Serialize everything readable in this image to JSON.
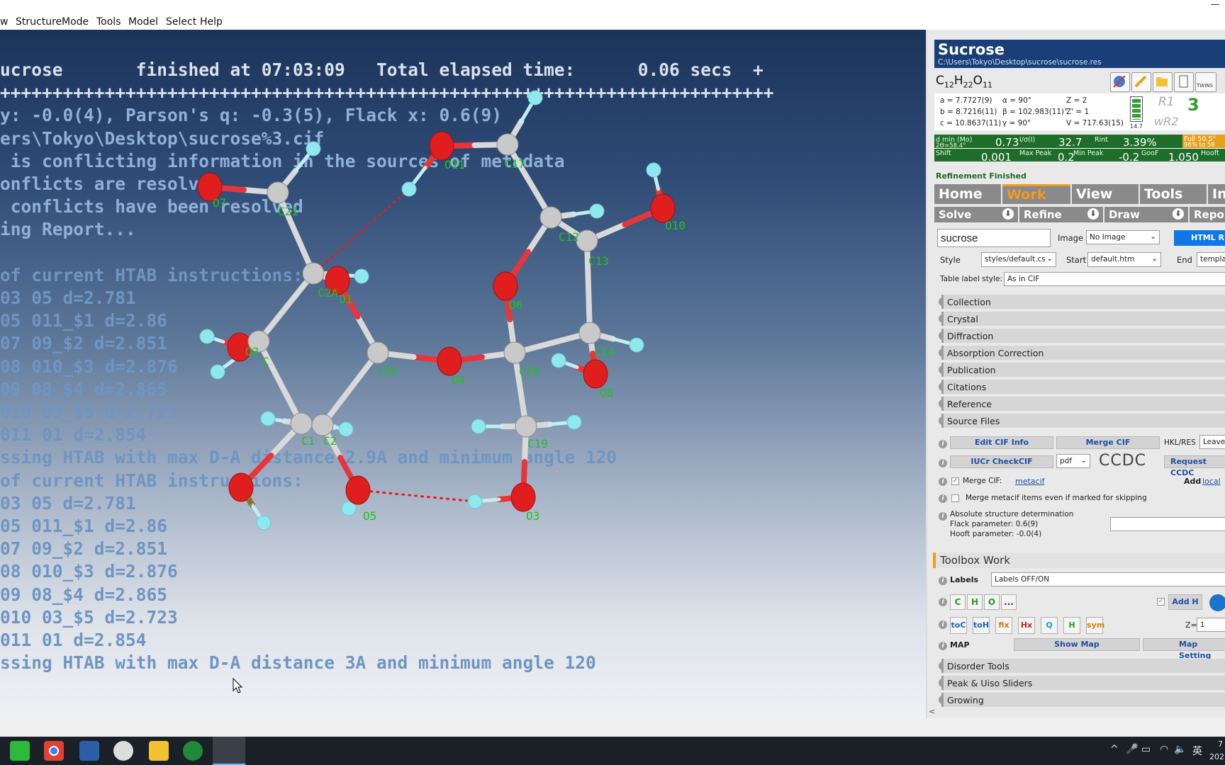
{
  "menu": [
    "w",
    "Structure",
    "Mode",
    "Tools",
    "Model",
    "Select",
    "Help"
  ],
  "console": {
    "lines": [
      {
        "text": "ucrose       finished at 07:03:09   Total elapsed time:      0.06 secs  +",
        "color": "#d8e1ec"
      },
      {
        "text": "++++++++++++++++++++++++++++++++++++++++++++++++++++++++++++++++++++++++++",
        "color": "#d8e1ec"
      },
      {
        "text": "y: -0.0(4), Parson's q: -0.3(5), Flack x: 0.6(9)",
        "color": "#8fb0d8"
      },
      {
        "text": "ers\\Tokyo\\Desktop\\sucrose%3.cif",
        "color": "#8fb0d8"
      },
      {
        "text": " is conflicting information in the sources of metadata",
        "color": "#8fb0d8"
      },
      {
        "text": "onflicts are resolved",
        "color": "#8fb0d8"
      },
      {
        "text": " conflicts have been resolved",
        "color": "#8fb0d8"
      },
      {
        "text": "ing Report...",
        "color": "#8fb0d8"
      },
      {
        "text": "",
        "color": "#8fb0d8"
      },
      {
        "text": "of current HTAB instructions:",
        "color": "#6f95c2"
      },
      {
        "text": "03 05 d=2.781",
        "color": "#6f95c2"
      },
      {
        "text": "05 011_$1 d=2.86",
        "color": "#6f95c2"
      },
      {
        "text": "07 09_$2 d=2.851",
        "color": "#6f95c2"
      },
      {
        "text": "08 010_$3 d=2.876",
        "color": "#6f95c2"
      },
      {
        "text": "09 08_$4 d=2.865",
        "color": "#6f95c2"
      },
      {
        "text": "010 03_$5 d=2.723",
        "color": "#6f95c2"
      },
      {
        "text": "011 01 d=2.854",
        "color": "#6f95c2"
      },
      {
        "text": "ssing HTAB with max D-A distance 2.9A and minimum angle 120",
        "color": "#6f95c2"
      },
      {
        "text": "of current HTAB instructions:",
        "color": "#6f95c2"
      },
      {
        "text": "03 05 d=2.781",
        "color": "#6f95c2"
      },
      {
        "text": "05 011_$1 d=2.86",
        "color": "#6f95c2"
      },
      {
        "text": "07 09_$2 d=2.851",
        "color": "#6f95c2"
      },
      {
        "text": "08 010_$3 d=2.876",
        "color": "#6f95c2"
      },
      {
        "text": "09 08_$4 d=2.865",
        "color": "#6f95c2"
      },
      {
        "text": "010 03_$5 d=2.723",
        "color": "#6f95c2"
      },
      {
        "text": "011 01 d=2.854",
        "color": "#6f95c2"
      },
      {
        "text": "ssing HTAB with max D-A distance 3A and minimum angle 120",
        "color": "#6f95c2"
      }
    ]
  },
  "molecule": {
    "label_color": "#1ec21e",
    "oxygen_color": "#e01e1e",
    "hydrogen_color": "#8fe8ee",
    "carbon_color": "#c9c9c9",
    "atom_labels": [
      "O11",
      "C17",
      "O7",
      "C21",
      "C12",
      "O10",
      "C13",
      "C2A",
      "O1",
      "O2",
      "C",
      "O6",
      "C5A",
      "O4",
      "C10",
      "C14",
      "O8",
      "C1",
      "C2",
      "C19",
      "O",
      "O5",
      "O3"
    ]
  },
  "panel": {
    "title": "Sucrose",
    "path": "C:\\Users\\Tokyo\\Desktop\\sucrose\\sucrose.res",
    "formula": [
      "C",
      "12",
      "H",
      "22",
      "O",
      "11"
    ],
    "twins_label": "TWINS",
    "cell": {
      "a": "a = 7.7727(9)",
      "b": "b = 8.7216(11)",
      "c": "c = 10.8637(11)",
      "alpha": "α = 90°",
      "beta": "β = 102.983(11)°",
      "gamma": "γ = 90°",
      "Z": "Z = 2",
      "Zp": "Z' = 1",
      "V": "V = 717.63(15)"
    },
    "battery_value": "14.7",
    "r1_label": "R1",
    "wr2_label": "wR2",
    "r1_value": "3",
    "stats_row1": [
      {
        "label": "d min (Mo)",
        "label2": "2Θ=58.4°",
        "value": "0.73"
      },
      {
        "label": "I/σ(I)",
        "value": "32.7"
      },
      {
        "label": "Rint",
        "value": "3.39%"
      },
      {
        "label": "Full 50.5°",
        "label2": "96% to 58"
      }
    ],
    "stats_row2": [
      {
        "label": "Shift",
        "value": "0.001"
      },
      {
        "label": "Max Peak",
        "value": "0.2"
      },
      {
        "label": "Min Peak",
        "value": "-0.2"
      },
      {
        "label": "GooF",
        "value": "1.050"
      },
      {
        "label": "Hooft"
      }
    ],
    "status": "Refinement Finished",
    "tabs": [
      "Home",
      "Work",
      "View",
      "Tools",
      "In"
    ],
    "subtabs": [
      "Solve",
      "Refine",
      "Draw",
      "Report"
    ],
    "report": {
      "name_value": "sucrose",
      "image_label": "Image",
      "image_value": "No Image",
      "html_button": "HTML R",
      "style_label": "Style",
      "style_value": "styles/default.cs",
      "start_label": "Start",
      "start_value": "default.htm",
      "end_label": "End",
      "end_value": "template",
      "table_label_style_label": "Table label style:",
      "table_label_style_value": "As in CIF"
    },
    "sections": [
      "Collection",
      "Crystal",
      "Diffraction",
      "Absorption Correction",
      "Publication",
      "Citations",
      "Reference",
      "Source Files"
    ],
    "cif": {
      "edit_cif": "Edit CIF Info",
      "merge_cif": "Merge CIF",
      "hklres_label": "HKL/RES",
      "hklres_value": "Leave",
      "iucr": "IUCr CheckCIF",
      "pdf_value": "pdf",
      "ccdc": "CCDC",
      "request_ccdc": "Request CCDC",
      "merge_cif_label": "Merge CIF:",
      "metacif_link": "metacif",
      "add_label": "Add",
      "local_link": "local",
      "merge_skip_label": "Merge metacif items even if marked for skipping",
      "abs_title": "Absolute structure determination",
      "flack": "Flack parameter: 0.6(9)",
      "hooft": "Hooft parameter: -0.0(4)"
    },
    "toolbox": {
      "title": "Toolbox Work",
      "labels_label": "Labels",
      "labels_value": "Labels OFF/ON",
      "elements": [
        "C",
        "H",
        "O",
        "..."
      ],
      "add_h": "Add H",
      "icons": [
        "toC",
        "toH",
        "fix",
        "Hx",
        "Q",
        "H",
        "sym"
      ],
      "z_label": "Z=",
      "z_value": "1",
      "map_label": "MAP",
      "show_map": "Show Map",
      "map_settings": "Map Setting",
      "more_sections": [
        "Disorder Tools",
        "Peak & Uiso Sliders",
        "Growing"
      ]
    }
  },
  "taskbar": {
    "apps": [
      "wechat",
      "chrome",
      "calculator",
      "olex2",
      "explorer",
      "chemdraw",
      "olex2-active"
    ],
    "tray_ime": "英",
    "clock_top": "7",
    "clock_bottom": "202"
  }
}
